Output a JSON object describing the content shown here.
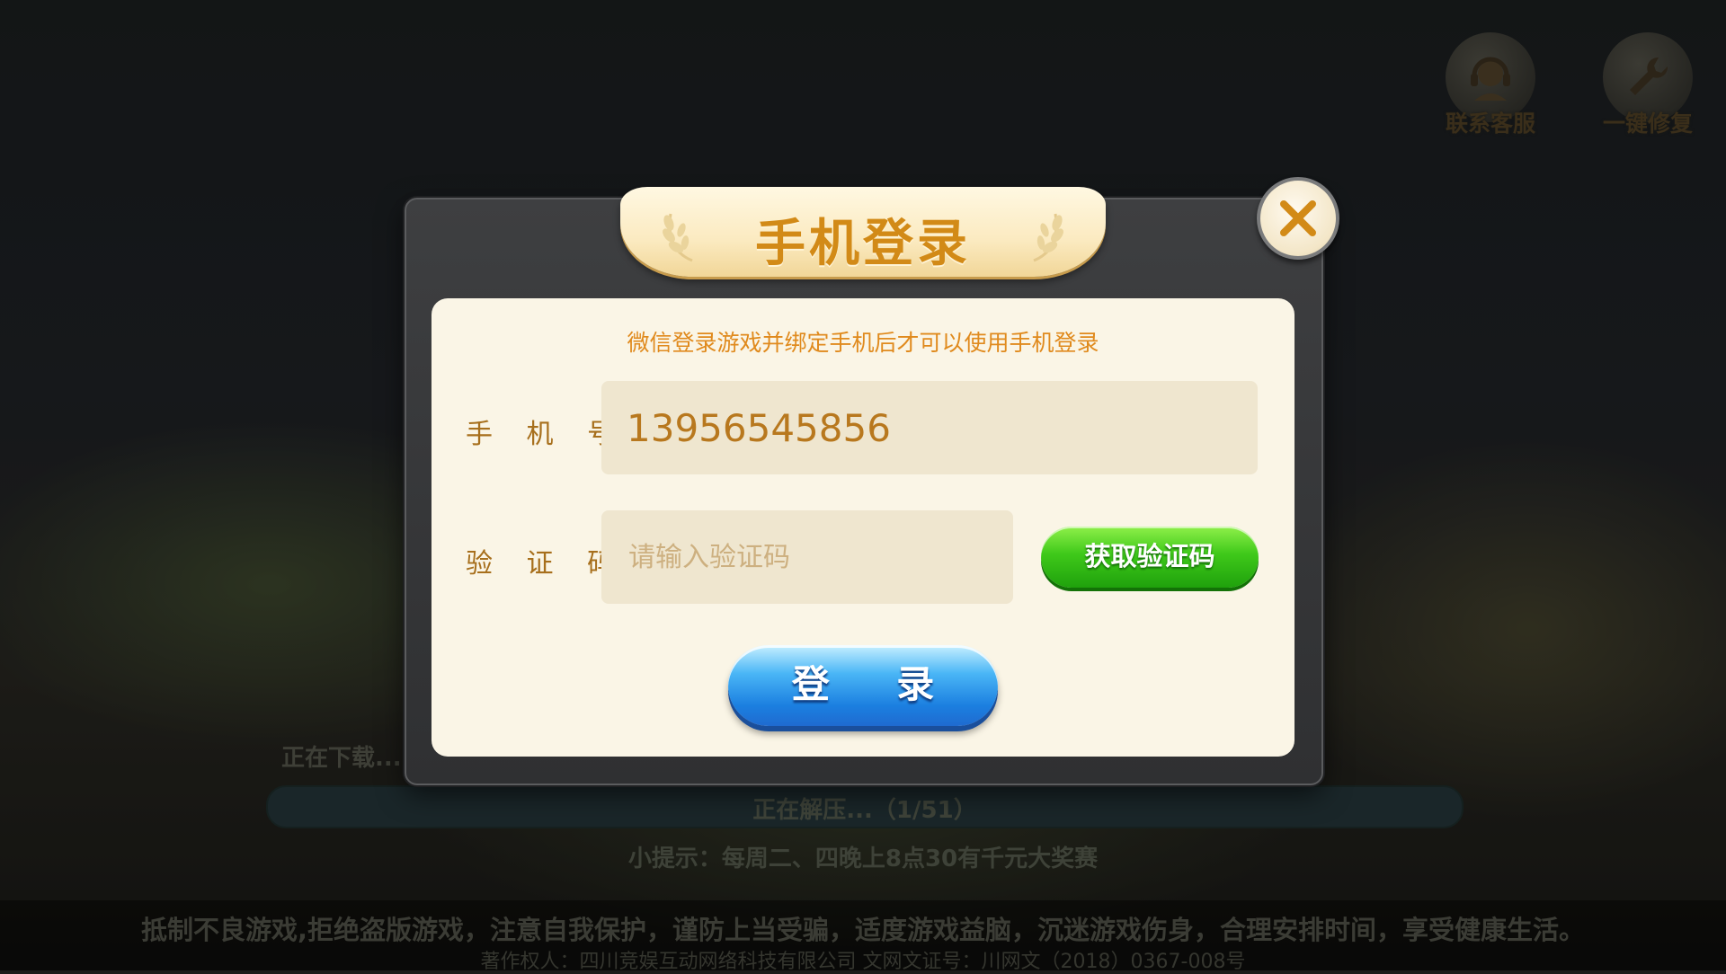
{
  "top_icons": {
    "support_label": "联系客服",
    "repair_label": "一键修复"
  },
  "background": {
    "downloading": "正在下载...",
    "extracting": "正在解压...（1/51）",
    "tip": "小提示：每周二、四晚上8点30有千元大奖赛",
    "health_notice": "抵制不良游戏,拒绝盗版游戏，注意自我保护，谨防上当受骗，适度游戏益脑，沉迷游戏伤身，合理安排时间，享受健康生活。",
    "copyright": "著作权人：四川竞娱互动网络科技有限公司    文网文证号：川网文（2018）0367-008号"
  },
  "dialog": {
    "title": "手机登录",
    "hint": "微信登录游戏并绑定手机后才可以使用手机登录",
    "phone_label": "手 机 号:",
    "phone_value": "13956545856",
    "code_label": "验 证 码:",
    "code_placeholder": "请输入验证码",
    "get_code_label": "获取验证码",
    "login_label": "登 录"
  },
  "colors": {
    "accent_gold": "#d28a17",
    "hint_orange": "#e08a1d",
    "green_button": "#3fc91a",
    "blue_button": "#1b7fe0"
  }
}
